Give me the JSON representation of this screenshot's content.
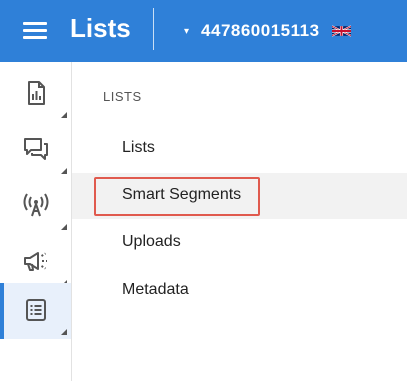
{
  "header": {
    "title": "Lists",
    "account_number": "447860015113",
    "account_caret": "▾",
    "flag_icon": "uk-flag-icon",
    "color": "#2f80d8"
  },
  "sidebar": {
    "items": [
      {
        "name": "reports",
        "icon": "report-document-icon",
        "active": false
      },
      {
        "name": "messages",
        "icon": "chat-bubbles-icon",
        "active": false
      },
      {
        "name": "broadcast",
        "icon": "antenna-signal-icon",
        "active": false
      },
      {
        "name": "campaigns",
        "icon": "megaphone-icon",
        "active": false
      },
      {
        "name": "lists",
        "icon": "list-icon",
        "active": true
      }
    ]
  },
  "content": {
    "section_title": "LISTS",
    "menu": [
      {
        "label": "Lists",
        "hover": false
      },
      {
        "label": "Smart Segments",
        "hover": true,
        "highlighted": true
      },
      {
        "label": "Uploads",
        "hover": false
      },
      {
        "label": "Metadata",
        "hover": false
      }
    ]
  }
}
